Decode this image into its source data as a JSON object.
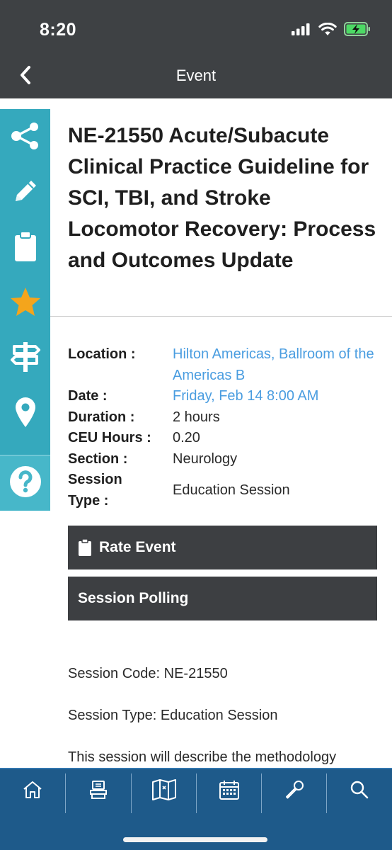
{
  "status_bar": {
    "time": "8:20"
  },
  "nav": {
    "title": "Event",
    "back_icon": "chevron-left-icon"
  },
  "side_rail": {
    "items": [
      {
        "name": "share",
        "icon": "share-icon"
      },
      {
        "name": "notes",
        "icon": "pencil-icon"
      },
      {
        "name": "clipboard",
        "icon": "clipboard-icon"
      },
      {
        "name": "favorite",
        "icon": "star-icon"
      },
      {
        "name": "signpost",
        "icon": "signpost-icon"
      },
      {
        "name": "location",
        "icon": "map-pin-icon"
      },
      {
        "name": "help",
        "icon": "help-icon",
        "label": "?"
      }
    ],
    "color": "#35a9bd",
    "star_color": "#f4a51c"
  },
  "event": {
    "title": "NE-21550 Acute/Subacute Clinical Practice Guideline for SCI, TBI, and Stroke Locomotor Recovery: Process and Outcomes Update"
  },
  "details": {
    "location": {
      "label": "Location :",
      "value": "Hilton Americas, Ballroom of the Americas B"
    },
    "date": {
      "label": "Date :",
      "value": "Friday, Feb 14 8:00 AM"
    },
    "duration": {
      "label": "Duration :",
      "value": "2 hours"
    },
    "ceu": {
      "label": "CEU Hours :",
      "value": "0.20"
    },
    "section": {
      "label": "Section :",
      "value": "Neurology"
    },
    "session_type": {
      "label": "Session Type :",
      "value": "Education Session"
    }
  },
  "actions": {
    "rate": "Rate Event",
    "polling": "Session Polling"
  },
  "description": {
    "code": "Session Code: NE-21550",
    "type": "Session Type: Education Session",
    "body": "This session will describe the methodology"
  },
  "tab_bar": {
    "tabs": [
      "home-icon",
      "exhibitor-booth-icon",
      "map-icon",
      "calendar-icon",
      "microphone-icon",
      "search-icon"
    ],
    "color": "#1e5a8a"
  },
  "colors": {
    "link": "#4a9de0",
    "header": "#3e4144",
    "button": "#3d3f42"
  }
}
